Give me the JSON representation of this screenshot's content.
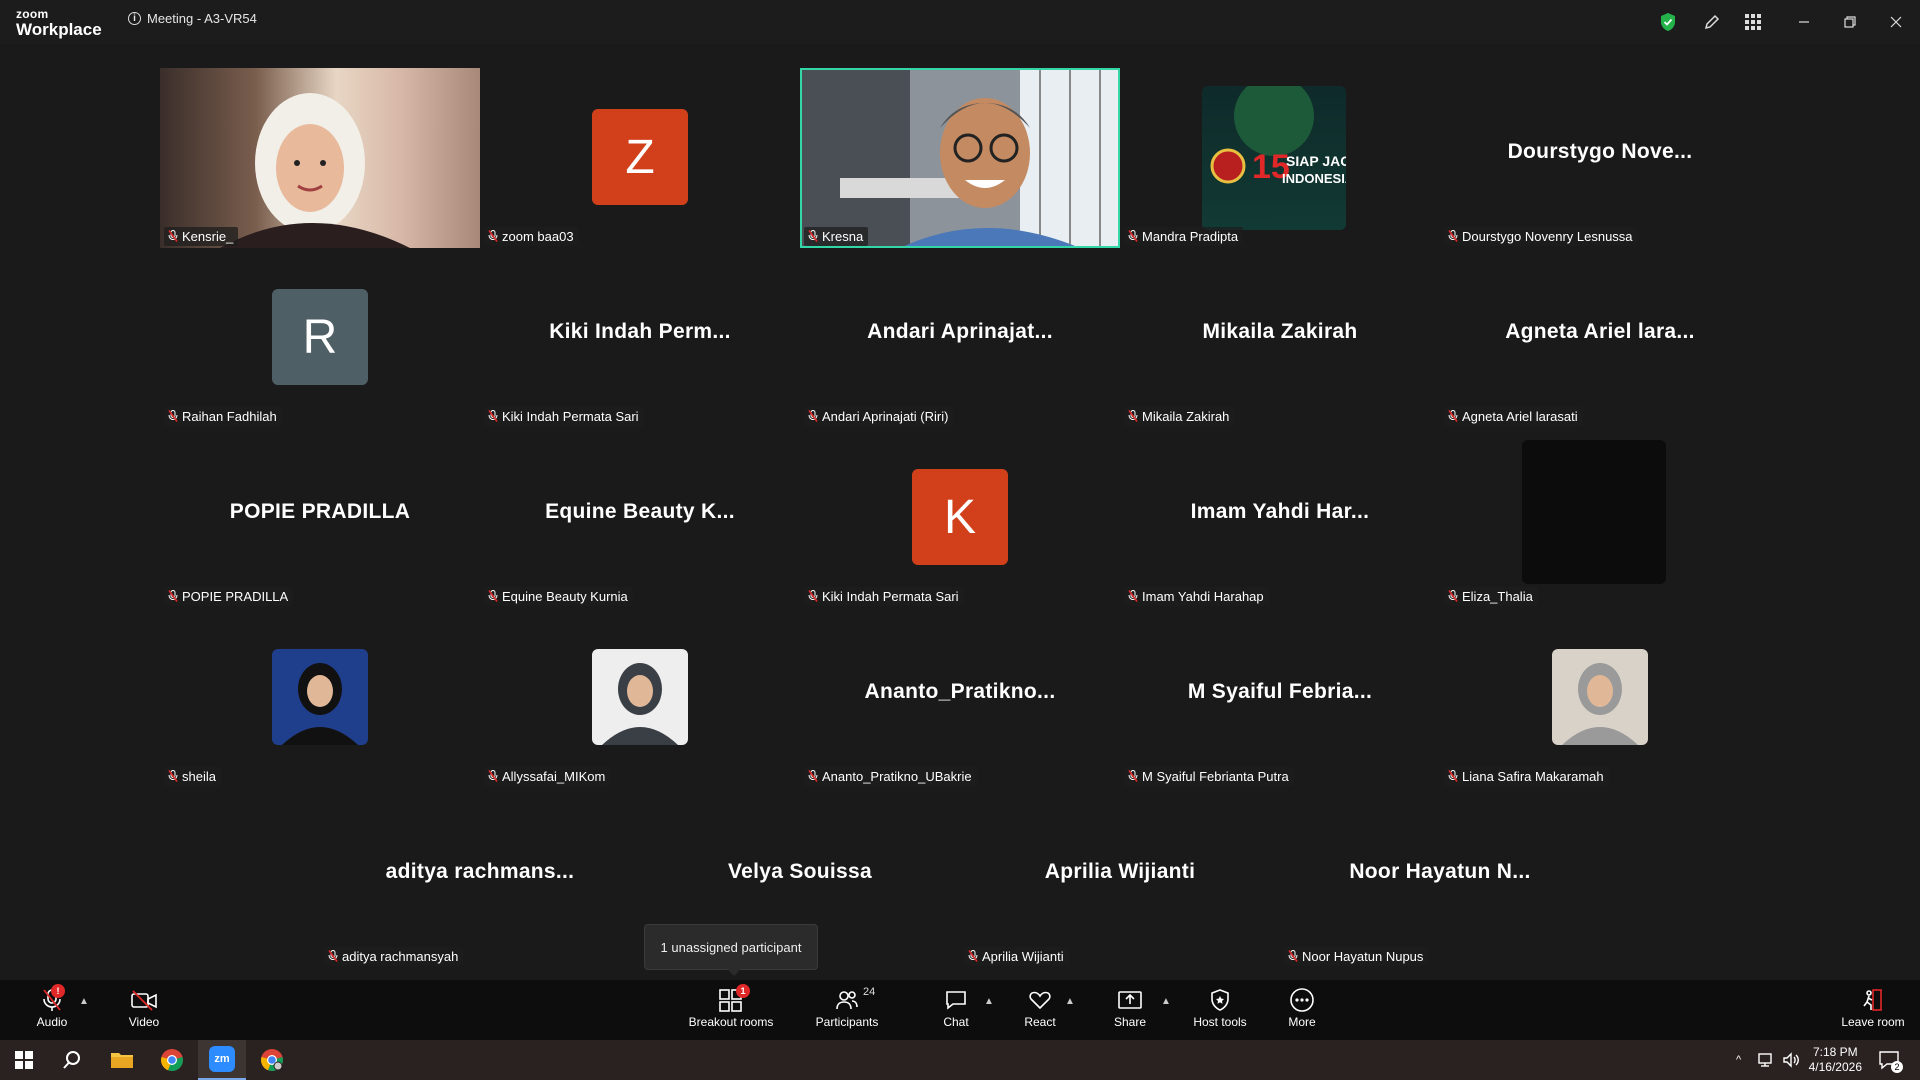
{
  "app": {
    "logo_line1": "zoom",
    "logo_line2": "Workplace",
    "meeting_title": "Meeting - A3-VR54"
  },
  "colors": {
    "accent_border": "#33d6a6",
    "shield": "#24b34a",
    "avatar_orange": "#d1401b",
    "avatar_slate": "#4f5f66",
    "badge": "#e02828"
  },
  "tiles": [
    {
      "row": 0,
      "col": 0,
      "type": "video",
      "label": "Kensrie_"
    },
    {
      "row": 0,
      "col": 1,
      "type": "letter",
      "letter": "Z",
      "label": "zoom baa03"
    },
    {
      "row": 0,
      "col": 2,
      "type": "video",
      "label": "Kresna",
      "active": true
    },
    {
      "row": 0,
      "col": 3,
      "type": "photo",
      "label": "Mandra Pradipta",
      "photo_text": "SIAP JAGA INDONESIA"
    },
    {
      "row": 0,
      "col": 4,
      "type": "name",
      "name": "Dourstygo  Nove...",
      "label": "Dourstygo Novenry Lesnussa"
    },
    {
      "row": 1,
      "col": 0,
      "type": "letter",
      "letter": "R",
      "label": "Raihan Fadhilah"
    },
    {
      "row": 1,
      "col": 1,
      "type": "name",
      "name": "Kiki Indah Perm...",
      "label": "Kiki Indah Permata Sari"
    },
    {
      "row": 1,
      "col": 2,
      "type": "name",
      "name": "Andari  Aprinajat...",
      "label": "Andari Aprinajati (Riri)"
    },
    {
      "row": 1,
      "col": 3,
      "type": "name",
      "name": "Mikaila Zakirah",
      "label": "Mikaila Zakirah"
    },
    {
      "row": 1,
      "col": 4,
      "type": "name",
      "name": "Agneta Ariel lara...",
      "label": "Agneta Ariel larasati"
    },
    {
      "row": 2,
      "col": 0,
      "type": "name",
      "name": "POPIE PRADILLA",
      "label": "POPIE PRADILLA"
    },
    {
      "row": 2,
      "col": 1,
      "type": "name",
      "name": "Equine Beauty K...",
      "label": "Equine Beauty Kurnia"
    },
    {
      "row": 2,
      "col": 2,
      "type": "letter",
      "letter": "K",
      "label": "Kiki Indah Permata Sari"
    },
    {
      "row": 2,
      "col": 3,
      "type": "name",
      "name": "Imam  Yahdi Har...",
      "label": "Imam Yahdi Harahap"
    },
    {
      "row": 2,
      "col": 4,
      "type": "dark",
      "label": "Eliza_Thalia"
    },
    {
      "row": 3,
      "col": 0,
      "type": "photo",
      "label": "sheila"
    },
    {
      "row": 3,
      "col": 1,
      "type": "photo",
      "label": "Allyssafai_MIKom"
    },
    {
      "row": 3,
      "col": 2,
      "type": "name",
      "name": "Ananto_Pratikno...",
      "label": "Ananto_Pratikno_UBakrie"
    },
    {
      "row": 3,
      "col": 3,
      "type": "name",
      "name": "M  Syaiful Febria...",
      "label": "M Syaiful Febrianta Putra"
    },
    {
      "row": 3,
      "col": 4,
      "type": "photo",
      "label": "Liana Safira Makaramah"
    },
    {
      "row": 4,
      "col": 0,
      "type": "name",
      "name": "aditya  rachmans...",
      "label": "aditya rachmansyah"
    },
    {
      "row": 4,
      "col": 1,
      "type": "name",
      "name": "Velya Souissa",
      "label": ""
    },
    {
      "row": 4,
      "col": 2,
      "type": "name",
      "name": "Aprilia Wijianti",
      "label": "Aprilia Wijianti"
    },
    {
      "row": 4,
      "col": 3,
      "type": "name",
      "name": "Noor Hayatun N...",
      "label": "Noor Hayatun Nupus"
    }
  ],
  "tooltip": "1 unassigned participant",
  "toolbar": {
    "audio": "Audio",
    "video": "Video",
    "breakout": "Breakout rooms",
    "breakout_badge": "1",
    "participants": "Participants",
    "participants_count": "24",
    "chat": "Chat",
    "react": "React",
    "share": "Share",
    "host_tools": "Host tools",
    "more": "More",
    "leave": "Leave room"
  },
  "taskbar": {
    "time": "7:18 PM",
    "date": "4/16/2026",
    "notif_count": "2",
    "zoom_label": "zm"
  }
}
